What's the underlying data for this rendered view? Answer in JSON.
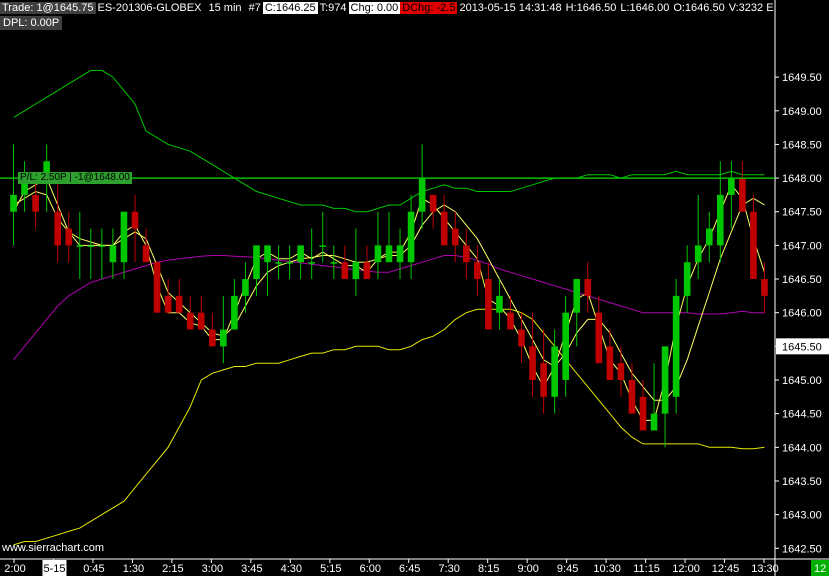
{
  "header": {
    "trade": "Trade: 1@1645.75",
    "symbol": "ES-201306-GLOBEX",
    "interval": "15 min",
    "chart_no": "#7",
    "close": "C:1646.25",
    "ticks": "T:974",
    "chg": "Chg: 0.00",
    "dchg": "DChg: -2.5",
    "datetime": "2013-05-15 14:31:48",
    "high": "H:1646.50",
    "low": "L:1646.00",
    "open": "O:1646.50",
    "volume": "V:3232 E"
  },
  "dpl": "DPL: 0.00P",
  "watermark": "www.sierrachart.com",
  "pl_label": "P/L: 2.50P | -1@1648.00",
  "colors": {
    "up": "#00c800",
    "down": "#c00000",
    "bollinger": "#00c800",
    "bollinger_lower": "#e8e800",
    "mid_avg": "#b000b0",
    "fast_avg": "#ffff60",
    "position_line": "#00c000"
  },
  "chart_data": {
    "type": "candlestick",
    "ylim": [
      1642.4,
      1650.2
    ],
    "y_ticks": [
      "1642.50",
      "1643.00",
      "1643.50",
      "1644.00",
      "1644.50",
      "1645.00",
      "1645.50",
      "1646.00",
      "1646.50",
      "1647.00",
      "1647.50",
      "1648.00",
      "1648.50",
      "1649.00",
      "1649.50"
    ],
    "current_price_label": "1645.50",
    "x_tick_labels": [
      "2:00",
      "5-15",
      "0:45",
      "1:30",
      "2:15",
      "3:00",
      "3:45",
      "4:30",
      "5:15",
      "6:00",
      "6:45",
      "7:30",
      "8:15",
      "9:00",
      "9:45",
      "10:30",
      "11:15",
      "12:00",
      "12:45",
      "13:30"
    ],
    "last_bar_count_label": "12",
    "position_price": 1648.0,
    "candles": [
      {
        "o": 1647.5,
        "h": 1648.5,
        "l": 1647.0,
        "c": 1647.75
      },
      {
        "o": 1647.75,
        "h": 1648.25,
        "l": 1647.5,
        "c": 1648.0
      },
      {
        "o": 1647.75,
        "h": 1648.0,
        "l": 1647.25,
        "c": 1647.5
      },
      {
        "o": 1648.0,
        "h": 1648.5,
        "l": 1647.5,
        "c": 1648.25
      },
      {
        "o": 1647.5,
        "h": 1648.0,
        "l": 1646.75,
        "c": 1647.0
      },
      {
        "o": 1647.25,
        "h": 1647.5,
        "l": 1646.75,
        "c": 1647.0
      },
      {
        "o": 1647.0,
        "h": 1647.5,
        "l": 1646.5,
        "c": 1647.0
      },
      {
        "o": 1647.0,
        "h": 1647.25,
        "l": 1646.5,
        "c": 1647.0
      },
      {
        "o": 1647.0,
        "h": 1647.25,
        "l": 1646.5,
        "c": 1647.0
      },
      {
        "o": 1646.75,
        "h": 1647.25,
        "l": 1646.5,
        "c": 1647.0
      },
      {
        "o": 1646.75,
        "h": 1647.5,
        "l": 1646.5,
        "c": 1647.5
      },
      {
        "o": 1647.5,
        "h": 1647.75,
        "l": 1646.75,
        "c": 1647.25
      },
      {
        "o": 1647.0,
        "h": 1647.25,
        "l": 1646.75,
        "c": 1646.75
      },
      {
        "o": 1646.75,
        "h": 1646.75,
        "l": 1646.0,
        "c": 1646.0
      },
      {
        "o": 1646.25,
        "h": 1646.5,
        "l": 1646.0,
        "c": 1646.0
      },
      {
        "o": 1646.25,
        "h": 1646.5,
        "l": 1646.0,
        "c": 1646.0
      },
      {
        "o": 1646.0,
        "h": 1646.25,
        "l": 1645.75,
        "c": 1645.75
      },
      {
        "o": 1646.0,
        "h": 1646.25,
        "l": 1645.75,
        "c": 1645.75
      },
      {
        "o": 1645.75,
        "h": 1646.0,
        "l": 1645.5,
        "c": 1645.5
      },
      {
        "o": 1645.5,
        "h": 1646.25,
        "l": 1645.25,
        "c": 1645.75
      },
      {
        "o": 1645.75,
        "h": 1646.5,
        "l": 1645.75,
        "c": 1646.25
      },
      {
        "o": 1646.25,
        "h": 1646.75,
        "l": 1646.0,
        "c": 1646.5
      },
      {
        "o": 1646.5,
        "h": 1647.0,
        "l": 1646.25,
        "c": 1647.0
      },
      {
        "o": 1646.75,
        "h": 1647.0,
        "l": 1646.25,
        "c": 1647.0
      },
      {
        "o": 1646.75,
        "h": 1647.0,
        "l": 1646.5,
        "c": 1646.75
      },
      {
        "o": 1646.75,
        "h": 1647.0,
        "l": 1646.5,
        "c": 1646.75
      },
      {
        "o": 1646.75,
        "h": 1647.0,
        "l": 1646.5,
        "c": 1647.0
      },
      {
        "o": 1646.75,
        "h": 1647.25,
        "l": 1646.5,
        "c": 1646.75
      },
      {
        "o": 1647.0,
        "h": 1647.5,
        "l": 1646.75,
        "c": 1647.0
      },
      {
        "o": 1646.75,
        "h": 1647.0,
        "l": 1646.5,
        "c": 1646.75
      },
      {
        "o": 1646.75,
        "h": 1647.0,
        "l": 1646.5,
        "c": 1646.5
      },
      {
        "o": 1646.5,
        "h": 1647.25,
        "l": 1646.25,
        "c": 1646.75
      },
      {
        "o": 1646.75,
        "h": 1647.0,
        "l": 1646.5,
        "c": 1646.5
      },
      {
        "o": 1646.75,
        "h": 1647.5,
        "l": 1646.5,
        "c": 1647.0
      },
      {
        "o": 1646.75,
        "h": 1647.5,
        "l": 1646.75,
        "c": 1647.0
      },
      {
        "o": 1646.75,
        "h": 1647.25,
        "l": 1646.5,
        "c": 1647.0
      },
      {
        "o": 1646.75,
        "h": 1647.75,
        "l": 1646.5,
        "c": 1647.5
      },
      {
        "o": 1647.5,
        "h": 1648.5,
        "l": 1647.25,
        "c": 1648.0
      },
      {
        "o": 1647.75,
        "h": 1647.75,
        "l": 1647.25,
        "c": 1647.5
      },
      {
        "o": 1647.5,
        "h": 1647.75,
        "l": 1647.0,
        "c": 1647.0
      },
      {
        "o": 1647.25,
        "h": 1647.5,
        "l": 1646.75,
        "c": 1647.0
      },
      {
        "o": 1647.0,
        "h": 1647.25,
        "l": 1646.5,
        "c": 1646.75
      },
      {
        "o": 1646.75,
        "h": 1647.0,
        "l": 1646.25,
        "c": 1646.5
      },
      {
        "o": 1646.5,
        "h": 1646.75,
        "l": 1645.75,
        "c": 1645.75
      },
      {
        "o": 1646.0,
        "h": 1646.5,
        "l": 1645.75,
        "c": 1646.25
      },
      {
        "o": 1646.0,
        "h": 1646.25,
        "l": 1645.75,
        "c": 1645.75
      },
      {
        "o": 1645.75,
        "h": 1646.0,
        "l": 1645.25,
        "c": 1645.5
      },
      {
        "o": 1645.5,
        "h": 1646.0,
        "l": 1644.75,
        "c": 1645.0
      },
      {
        "o": 1645.25,
        "h": 1645.75,
        "l": 1644.5,
        "c": 1644.75
      },
      {
        "o": 1644.75,
        "h": 1645.75,
        "l": 1644.5,
        "c": 1645.5
      },
      {
        "o": 1645.0,
        "h": 1646.25,
        "l": 1644.75,
        "c": 1646.0
      },
      {
        "o": 1646.0,
        "h": 1646.5,
        "l": 1645.5,
        "c": 1646.5
      },
      {
        "o": 1646.5,
        "h": 1646.75,
        "l": 1646.0,
        "c": 1646.25
      },
      {
        "o": 1646.0,
        "h": 1646.25,
        "l": 1645.25,
        "c": 1645.25
      },
      {
        "o": 1645.5,
        "h": 1645.75,
        "l": 1645.0,
        "c": 1645.0
      },
      {
        "o": 1645.25,
        "h": 1645.5,
        "l": 1644.75,
        "c": 1645.0
      },
      {
        "o": 1645.0,
        "h": 1645.25,
        "l": 1644.5,
        "c": 1644.5
      },
      {
        "o": 1644.75,
        "h": 1645.0,
        "l": 1644.25,
        "c": 1644.25
      },
      {
        "o": 1644.25,
        "h": 1645.25,
        "l": 1644.25,
        "c": 1644.5
      },
      {
        "o": 1644.5,
        "h": 1645.5,
        "l": 1644.0,
        "c": 1645.5
      },
      {
        "o": 1644.75,
        "h": 1646.5,
        "l": 1644.5,
        "c": 1646.25
      },
      {
        "o": 1646.25,
        "h": 1647.0,
        "l": 1646.0,
        "c": 1646.75
      },
      {
        "o": 1646.75,
        "h": 1647.75,
        "l": 1646.5,
        "c": 1647.0
      },
      {
        "o": 1647.0,
        "h": 1647.5,
        "l": 1646.75,
        "c": 1647.25
      },
      {
        "o": 1647.0,
        "h": 1648.25,
        "l": 1646.75,
        "c": 1647.75
      },
      {
        "o": 1647.75,
        "h": 1648.25,
        "l": 1647.25,
        "c": 1648.0
      },
      {
        "o": 1648.0,
        "h": 1648.25,
        "l": 1647.5,
        "c": 1647.5
      },
      {
        "o": 1647.5,
        "h": 1647.75,
        "l": 1646.5,
        "c": 1646.5
      },
      {
        "o": 1646.5,
        "h": 1646.75,
        "l": 1646.0,
        "c": 1646.25
      }
    ],
    "series": [
      {
        "values": [
          1648.9,
          1649.0,
          1649.1,
          1649.2,
          1649.3,
          1649.4,
          1649.5,
          1649.6,
          1649.6,
          1649.5,
          1649.3,
          1649.1,
          1648.7,
          1648.6,
          1648.5,
          1648.45,
          1648.4,
          1648.3,
          1648.2,
          1648.1,
          1648.0,
          1647.9,
          1647.8,
          1647.75,
          1647.7,
          1647.65,
          1647.6,
          1647.6,
          1647.6,
          1647.55,
          1647.55,
          1647.5,
          1647.5,
          1647.55,
          1647.6,
          1647.6,
          1647.7,
          1647.8,
          1647.85,
          1647.9,
          1647.85,
          1647.85,
          1647.8,
          1647.8,
          1647.8,
          1647.8,
          1647.85,
          1647.9,
          1647.95,
          1648.0,
          1648.0,
          1648.0,
          1648.05,
          1648.05,
          1648.05,
          1648.0,
          1648.05,
          1648.05,
          1648.05,
          1648.05,
          1648.1,
          1648.05,
          1648.05,
          1648.05,
          1648.05,
          1648.1,
          1648.05,
          1648.05,
          1648.05
        ]
      },
      {
        "values": [
          1642.55,
          1642.6,
          1642.6,
          1642.65,
          1642.7,
          1642.75,
          1642.8,
          1642.9,
          1643.0,
          1643.1,
          1643.2,
          1643.4,
          1643.6,
          1643.8,
          1644.0,
          1644.3,
          1644.6,
          1645.0,
          1645.1,
          1645.15,
          1645.2,
          1645.2,
          1645.25,
          1645.25,
          1645.25,
          1645.3,
          1645.35,
          1645.4,
          1645.4,
          1645.45,
          1645.45,
          1645.5,
          1645.5,
          1645.5,
          1645.45,
          1645.45,
          1645.5,
          1645.6,
          1645.65,
          1645.75,
          1645.9,
          1646.0,
          1646.05,
          1646.05,
          1646.05,
          1646.05,
          1646.0,
          1645.9,
          1645.7,
          1645.5,
          1645.3,
          1645.1,
          1644.9,
          1644.7,
          1644.5,
          1644.3,
          1644.15,
          1644.05,
          1644.05,
          1644.05,
          1644.05,
          1644.05,
          1644.05,
          1644.0,
          1644.0,
          1644.0,
          1643.98,
          1643.98,
          1644.0
        ]
      },
      {
        "values": [
          1645.3,
          1645.5,
          1645.7,
          1645.9,
          1646.1,
          1646.25,
          1646.35,
          1646.45,
          1646.5,
          1646.55,
          1646.6,
          1646.65,
          1646.7,
          1646.75,
          1646.78,
          1646.8,
          1646.82,
          1646.84,
          1646.85,
          1646.85,
          1646.84,
          1646.83,
          1646.82,
          1646.8,
          1646.78,
          1646.76,
          1646.74,
          1646.72,
          1646.7,
          1646.68,
          1646.66,
          1646.64,
          1646.62,
          1646.6,
          1646.6,
          1646.65,
          1646.7,
          1646.75,
          1646.8,
          1646.85,
          1646.85,
          1646.82,
          1646.78,
          1646.72,
          1646.65,
          1646.6,
          1646.55,
          1646.5,
          1646.45,
          1646.4,
          1646.35,
          1646.3,
          1646.25,
          1646.2,
          1646.15,
          1646.1,
          1646.05,
          1646.0,
          1646.0,
          1646.0,
          1646.0,
          1646.0,
          1645.98,
          1645.98,
          1645.98,
          1646.0,
          1646.02,
          1646.0,
          1646.0
        ]
      },
      {
        "values": [
          1647.6,
          1647.7,
          1647.8,
          1647.75,
          1647.4,
          1647.2,
          1647.1,
          1647.05,
          1647.0,
          1647.0,
          1647.1,
          1647.2,
          1647.1,
          1646.7,
          1646.3,
          1646.15,
          1646.0,
          1645.85,
          1645.7,
          1645.65,
          1645.8,
          1646.1,
          1646.4,
          1646.6,
          1646.7,
          1646.75,
          1646.8,
          1646.82,
          1646.85,
          1646.85,
          1646.8,
          1646.75,
          1646.75,
          1646.8,
          1646.85,
          1646.85,
          1647.0,
          1647.3,
          1647.5,
          1647.6,
          1647.5,
          1647.3,
          1647.1,
          1646.8,
          1646.5,
          1646.2,
          1645.9,
          1645.6,
          1645.3,
          1645.2,
          1645.4,
          1645.7,
          1645.9,
          1645.9,
          1645.7,
          1645.4,
          1645.1,
          1644.9,
          1644.7,
          1644.7,
          1644.9,
          1645.3,
          1645.8,
          1646.3,
          1646.8,
          1647.2,
          1647.6,
          1647.7,
          1647.6
        ]
      },
      {
        "values": [
          1647.5,
          1647.8,
          1647.9,
          1648.0,
          1647.6,
          1647.2,
          1647.0,
          1647.0,
          1647.0,
          1647.0,
          1647.2,
          1647.3,
          1647.0,
          1646.4,
          1646.0,
          1646.0,
          1645.85,
          1645.8,
          1645.6,
          1645.6,
          1646.0,
          1646.4,
          1646.8,
          1646.9,
          1646.8,
          1646.8,
          1646.9,
          1646.8,
          1646.9,
          1646.8,
          1646.7,
          1646.7,
          1646.6,
          1646.8,
          1646.9,
          1646.9,
          1647.2,
          1647.7,
          1647.6,
          1647.4,
          1647.2,
          1647.0,
          1646.8,
          1646.2,
          1646.1,
          1645.9,
          1645.6,
          1645.2,
          1644.9,
          1645.2,
          1645.7,
          1646.2,
          1646.3,
          1645.8,
          1645.3,
          1645.1,
          1644.7,
          1644.4,
          1644.4,
          1645.0,
          1645.8,
          1646.4,
          1646.8,
          1647.1,
          1647.5,
          1647.9,
          1647.7,
          1647.1,
          1646.6
        ]
      }
    ]
  }
}
